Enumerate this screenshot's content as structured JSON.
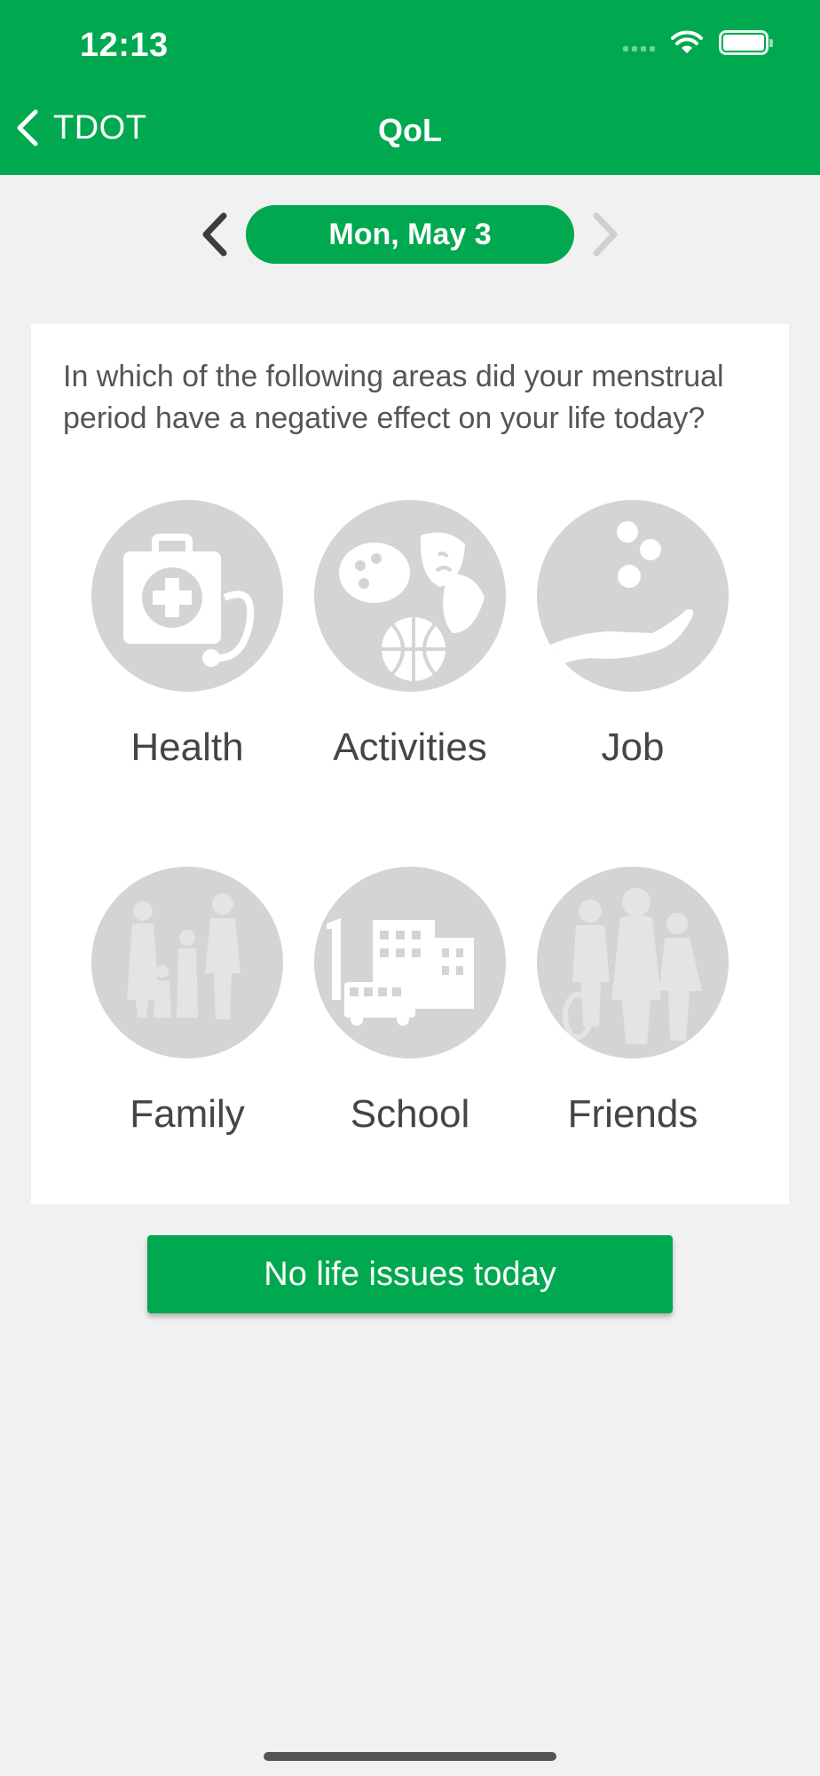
{
  "status_bar": {
    "time": "12:13",
    "icons": [
      "signal-icon",
      "wifi-icon",
      "battery-icon"
    ]
  },
  "nav": {
    "back_label": "TDOT",
    "title": "QoL",
    "back_icon": "chevron-left-icon"
  },
  "date_nav": {
    "date": "Mon, May 3",
    "prev_icon": "chevron-left-icon",
    "next_icon": "chevron-right-icon"
  },
  "question": "In which of the following areas did your menstrual period have a negative effect on your life today?",
  "options": [
    {
      "label": "Health",
      "icon": "health-icon"
    },
    {
      "label": "Activities",
      "icon": "activities-icon"
    },
    {
      "label": "Job",
      "icon": "job-icon"
    },
    {
      "label": "Family",
      "icon": "family-icon"
    },
    {
      "label": "School",
      "icon": "school-icon"
    },
    {
      "label": "Friends",
      "icon": "friends-icon"
    }
  ],
  "no_issues_button": "No life issues today",
  "colors": {
    "brand_green": "#00a94f",
    "option_gray": "#d4d4d4",
    "background": "#f1f1f1"
  }
}
